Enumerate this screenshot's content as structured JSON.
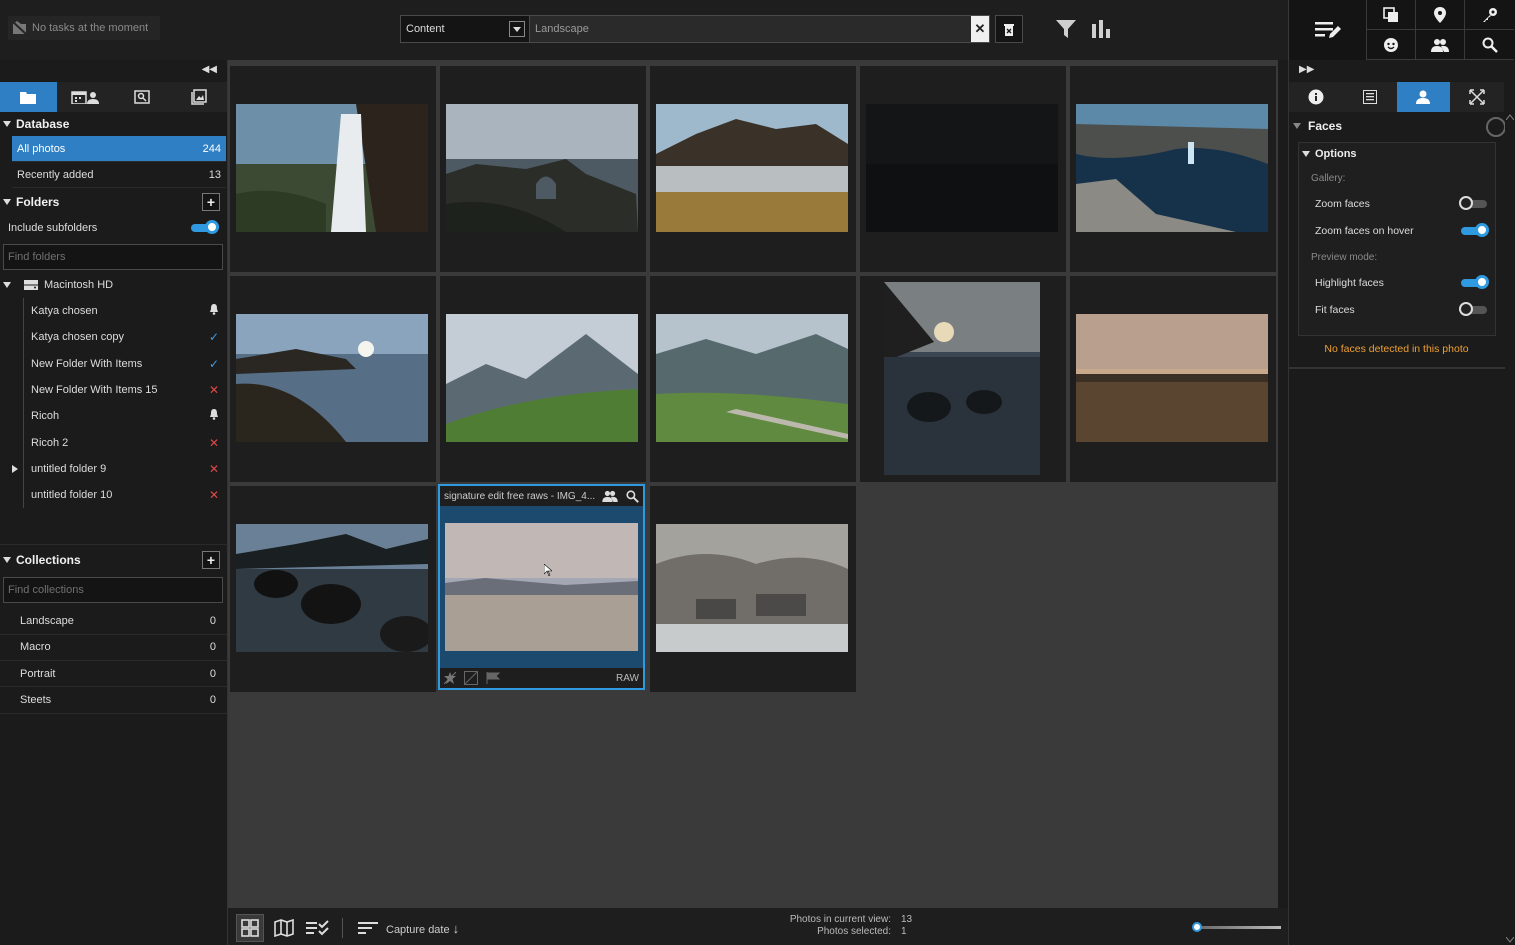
{
  "topbar": {
    "tasks_label": "No tasks at the moment",
    "search_field": "Content",
    "search_value": "Landscape"
  },
  "left": {
    "database": {
      "title": "Database",
      "items": [
        {
          "label": "All photos",
          "count": "244"
        },
        {
          "label": "Recently added",
          "count": "13"
        }
      ]
    },
    "folders": {
      "title": "Folders",
      "include_subfolders": "Include subfolders",
      "find_placeholder": "Find folders",
      "root": "Macintosh HD",
      "items": [
        {
          "label": "Katya chosen",
          "status": "bell"
        },
        {
          "label": "Katya chosen copy",
          "status": "ok"
        },
        {
          "label": "New Folder With Items",
          "status": "ok"
        },
        {
          "label": "New Folder With Items 15",
          "status": "error"
        },
        {
          "label": "Ricoh",
          "status": "bell"
        },
        {
          "label": "Ricoh 2",
          "status": "error"
        },
        {
          "label": "untitled folder 9",
          "status": "error"
        },
        {
          "label": "untitled folder 10",
          "status": "error"
        }
      ]
    },
    "collections": {
      "title": "Collections",
      "find_placeholder": "Find collections",
      "items": [
        {
          "label": "Landscape",
          "count": "0"
        },
        {
          "label": "Macro",
          "count": "0"
        },
        {
          "label": "Portrait",
          "count": "0"
        },
        {
          "label": "Steets",
          "count": "0"
        }
      ]
    }
  },
  "grid": {
    "selected_caption": "signature edit free raws - IMG_4...",
    "selected_badge": "RAW"
  },
  "bottombar": {
    "sort_label": "Capture date",
    "photos_in_view_label": "Photos in current view:",
    "photos_in_view": "13",
    "photos_selected_label": "Photos selected:",
    "photos_selected": "1"
  },
  "right": {
    "faces_title": "Faces",
    "options_title": "Options",
    "gallery_label": "Gallery:",
    "zoom_faces": "Zoom faces",
    "zoom_faces_hover": "Zoom faces on hover",
    "preview_label": "Preview mode:",
    "highlight_faces": "Highlight faces",
    "fit_faces": "Fit faces",
    "no_faces": "No faces detected in this photo"
  },
  "colors": {
    "accent": "#2f7fc4",
    "ok": "#3b9ee8",
    "error": "#e04848",
    "warning": "#f0a030"
  }
}
